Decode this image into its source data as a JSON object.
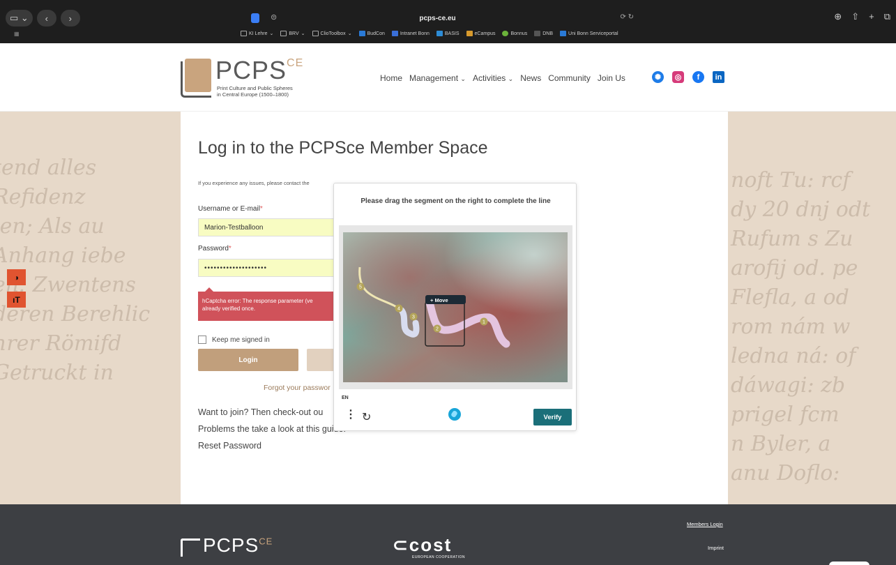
{
  "browser": {
    "url": "pcps-ce.eu",
    "bookmarks": [
      "KI Lehre",
      "BRV",
      "ClioToolbox",
      "BudCon",
      "Intranet Bonn",
      "BASIS",
      "eCampus",
      "Bonnus",
      "DNB",
      "Uni Bonn Serviceportal"
    ]
  },
  "site": {
    "logo_text": "PCPS",
    "logo_sup": "CE",
    "logo_tagline_1": "Print Culture and Public Spheres",
    "logo_tagline_2": "in Central Europe (1500–1800)",
    "nav": {
      "home": "Home",
      "management": "Management",
      "activities": "Activities",
      "news": "News",
      "community": "Community",
      "join": "Join Us"
    },
    "chevron": "⌄",
    "social_icons": [
      "bluesky-icon",
      "instagram-icon",
      "facebook-icon",
      "linkedin-icon"
    ]
  },
  "login": {
    "title": "Log in to the PCPSce Member Space",
    "info": "If you experience any issues, please contact the",
    "username_label": "Username or E-mail",
    "username_value": "Marion-Testballoon",
    "password_label": "Password",
    "password_value": "••••••••••••••••••••",
    "required": "*",
    "error_line1": "hCaptcha error: The response parameter (ve",
    "error_line2": "already verified once.",
    "remember": "Keep me signed in",
    "login_button": "Login",
    "forgot": "Forgot your passwor",
    "join_text": "Want to join? Then check-out ou",
    "problems_text": "Problems the take a look at this guide.",
    "reset_text": "Reset Password"
  },
  "captcha": {
    "prompt": "Please drag the segment on the right to complete the line",
    "move_label": "Move",
    "language": "EN",
    "verify": "Verify",
    "markers": [
      "1",
      "2",
      "3",
      "4",
      "5"
    ]
  },
  "sidetools": {
    "contrast": "◑",
    "textsize": "ıT"
  },
  "footer": {
    "logo_text": "PCPS",
    "logo_sup": "CE",
    "cost": "cost",
    "cost_sub": "EUROPEAN COOPERATION",
    "members_login": "Members Login",
    "imprint": "Imprint"
  },
  "background_text": {
    "left": [
      "tend alles",
      "Refidenz",
      "ien; Als au",
      "Anhang iebe",
      "en: Zwentens",
      "deren Berehlic",
      "hrer Römifd",
      "Getruckt in"
    ],
    "right": [
      "noft Tu: rcf",
      "dy 20 dnj odt",
      "Rufum s Zu",
      "arofij od. pe",
      "Flefla, a od",
      "rom nám w",
      "ledna ná: of",
      "dáwagi: zb",
      "prigel fcm",
      "n Byler, a",
      "anu Doflo:"
    ]
  },
  "colors": {
    "accent": "#c19f7c",
    "error": "#d0525a",
    "verify": "#1b6f79",
    "footer": "#3d3f43"
  }
}
